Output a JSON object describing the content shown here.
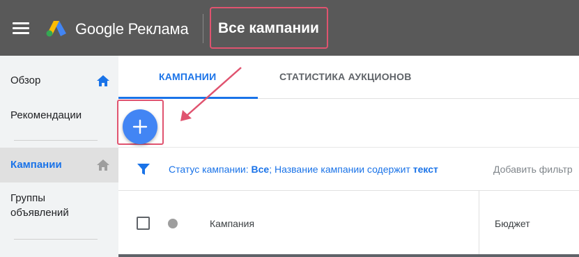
{
  "header": {
    "brand": "Google Реклама",
    "page_title": "Все кампании"
  },
  "sidebar": {
    "items": [
      {
        "label": "Обзор",
        "icon": "home-icon"
      },
      {
        "label": "Рекомендации"
      },
      {
        "label": "Кампании",
        "icon": "home-icon",
        "active": true
      },
      {
        "label": "Группы объявлений"
      }
    ]
  },
  "tabs": [
    {
      "label": "КАМПАНИИ",
      "active": true
    },
    {
      "label": "СТАТИСТИКА АУКЦИОНОВ",
      "active": false
    }
  ],
  "filter": {
    "status_label": "Статус кампании: ",
    "status_value": "Все",
    "name_label": "; Название кампании содержит ",
    "name_value": "текст",
    "add_filter": "Добавить фильтр"
  },
  "table": {
    "columns": [
      "Кампания",
      "Бюджет"
    ]
  },
  "colors": {
    "header_bg": "#595959",
    "accent": "#1a73e8",
    "fab": "#4285f4",
    "highlight": "#e0536f"
  }
}
